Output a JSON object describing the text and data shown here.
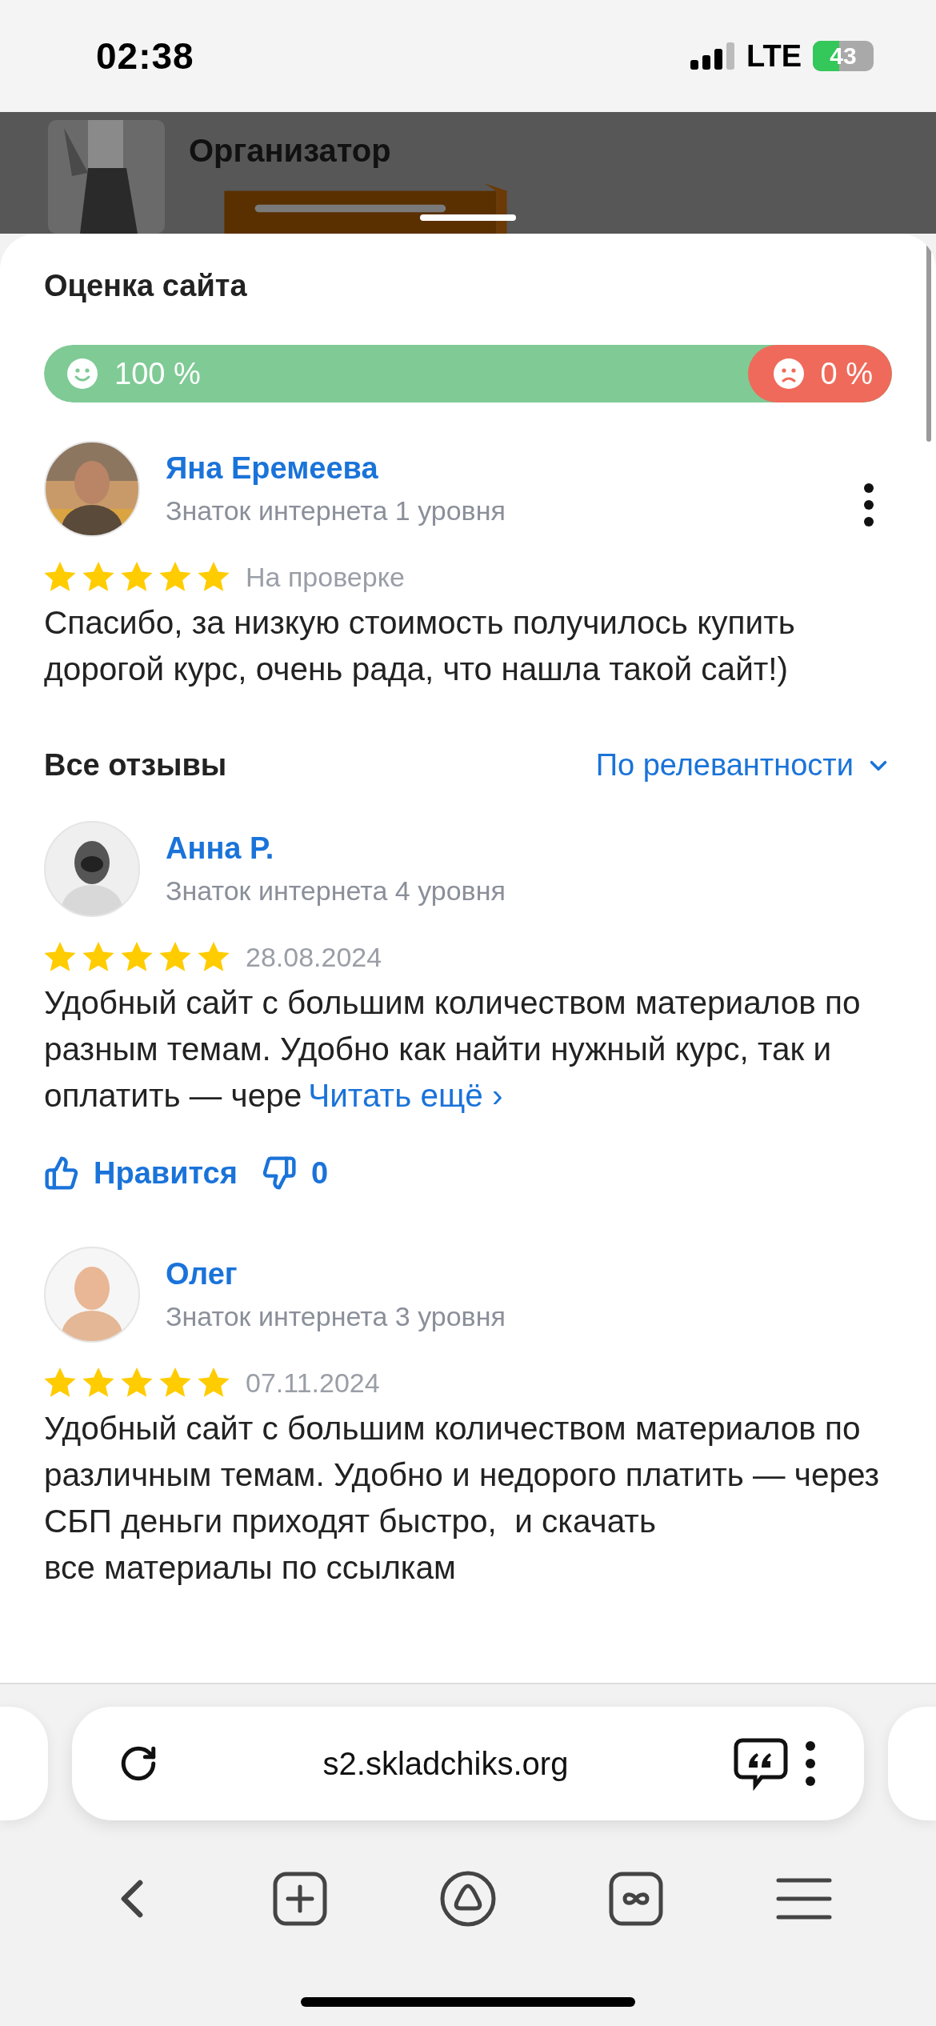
{
  "status_bar": {
    "time": "02:38",
    "network": "LTE",
    "battery": "43"
  },
  "background_page": {
    "title": "Организатор"
  },
  "sheet": {
    "title": "Оценка сайта",
    "rating": {
      "positive": {
        "label": "100 %",
        "level": 1
      },
      "negative": {
        "label": "0 %"
      }
    },
    "my_review": {
      "name": "Яна Еремеева",
      "rank": "Знаток интернета 1 уровня",
      "stars": 5,
      "status": "На проверке",
      "text": "Спасибо, за низкую стоимость получилось купить дорогой курс, очень рада, что нашла такой сайт!)"
    },
    "reviews_header": {
      "title": "Все отзывы",
      "sort": "По релевантности"
    },
    "reviews": [
      {
        "name": "Анна Р.",
        "rank": "Знаток интернета 4 уровня",
        "stars": 5,
        "date": "28.08.2024",
        "text": "Удобный сайт с большим количеством материалов по разным темам. Удобно как найти нужный курс, так и оплатить — чере",
        "read_more": "Читать ещё ›",
        "like_label": "Нравится",
        "dislikes": "0"
      },
      {
        "name": "Олег",
        "rank": "Знаток интернета 3 уровня",
        "stars": 5,
        "date": "07.11.2024",
        "text": "Удобный сайт с большим количеством материалов по различным темам. Удобно и недорого платить — через СБП деньги приходят быстро,  и скачать\nвсе материалы по ссылкам"
      }
    ]
  },
  "browser": {
    "url": "s2.skladchiks.org"
  }
}
